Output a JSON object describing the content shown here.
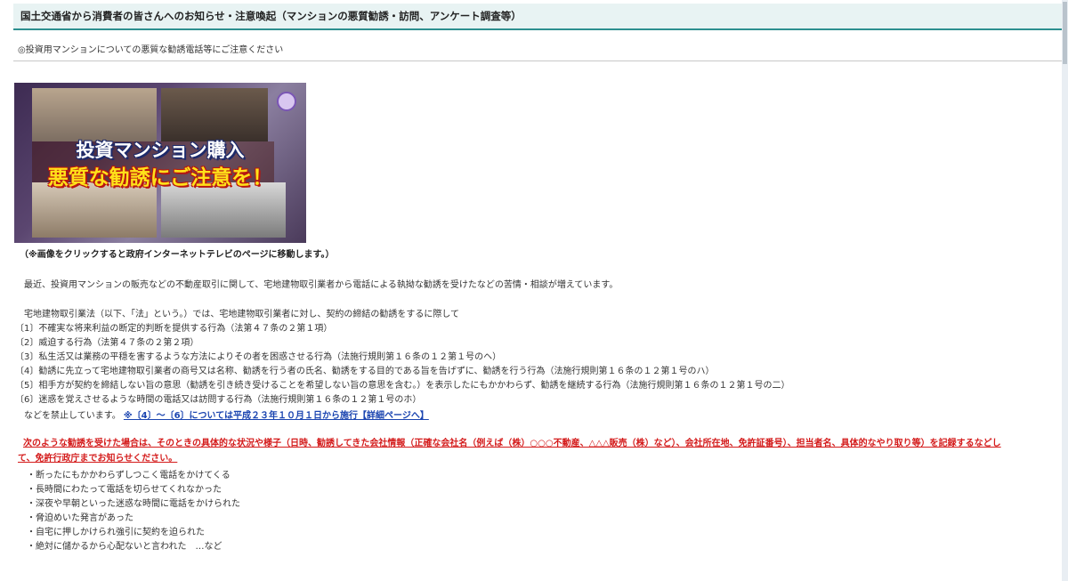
{
  "header": {
    "title": "国土交通省から消費者の皆さんへのお知らせ・注意喚起（マンションの悪質勧誘・訪問、アンケート調査等）"
  },
  "subtitle": "◎投資用マンションについての悪質な勧誘電話等にご注意ください",
  "banner": {
    "line1": "投資マンション購入",
    "line2": "悪質な勧誘にご注意を！"
  },
  "caption": "（※画像をクリックすると政府インターネットテレビのページに移動します。）",
  "intro": "最近、投資用マンションの販売などの不動産取引に関して、宅地建物取引業者から電話による執拗な勧誘を受けたなどの苦情・相談が増えています。",
  "law_intro": "宅地建物取引業法（以下、「法」という。）では、宅地建物取引業者に対し、契約の締結の勧誘をするに際して",
  "prohibitions": [
    "〔1〕不確実な将来利益の断定的判断を提供する行為（法第４７条の２第１項）",
    "〔2〕威迫する行為（法第４７条の２第２項）",
    "〔3〕私生活又は業務の平穏を害するような方法によりその者を困惑させる行為（法施行規則第１６条の１２第１号のヘ）",
    "〔4〕勧誘に先立って宅地建物取引業者の商号又は名称、勧誘を行う者の氏名、勧誘をする目的である旨を告げずに、勧誘を行う行為（法施行規則第１６条の１２第１号のハ）",
    "〔5〕相手方が契約を締結しない旨の意思（勧誘を引き続き受けることを希望しない旨の意思を含む。）を表示したにもかかわらず、勧誘を継続する行為（法施行規則第１６条の１２第１号の二）",
    "〔6〕迷惑を覚えさせるような時間の電話又は訪問する行為（法施行規則第１６条の１２第１号のホ）"
  ],
  "prohibited_text": "などを禁止しています。",
  "note_link": "※〔4〕～〔6〕については平成２３年１０月１日から施行【詳細ページへ】",
  "warning": {
    "line1": "次のような勧誘を受けた場合は、そのときの具体的な状況や様子（日時、勧誘してきた会社情報（正確な会社名（例えば（株）○○○不動産、△△△販売（株）など）、会社所在地、免許証番号）、担当者名、具体的なやり取り等）を記録するなどし",
    "line2": "て、免許行政庁までお知らせください。"
  },
  "examples": [
    "・断ったにもかかわらずしつこく電話をかけてくる",
    "・長時間にわたって電話を切らせてくれなかった",
    "・深夜や早朝といった迷惑な時間に電話をかけられた",
    "・脅迫めいた発言があった",
    "・自宅に押しかけられ強引に契約を迫られた",
    "・絶対に儲かるから心配ないと言われた　…など"
  ],
  "colors": {
    "header_bg": "#e8f3f3",
    "header_border": "#2d8f8f",
    "warning_red": "#d41b1b",
    "link_blue": "#1a44b0"
  }
}
